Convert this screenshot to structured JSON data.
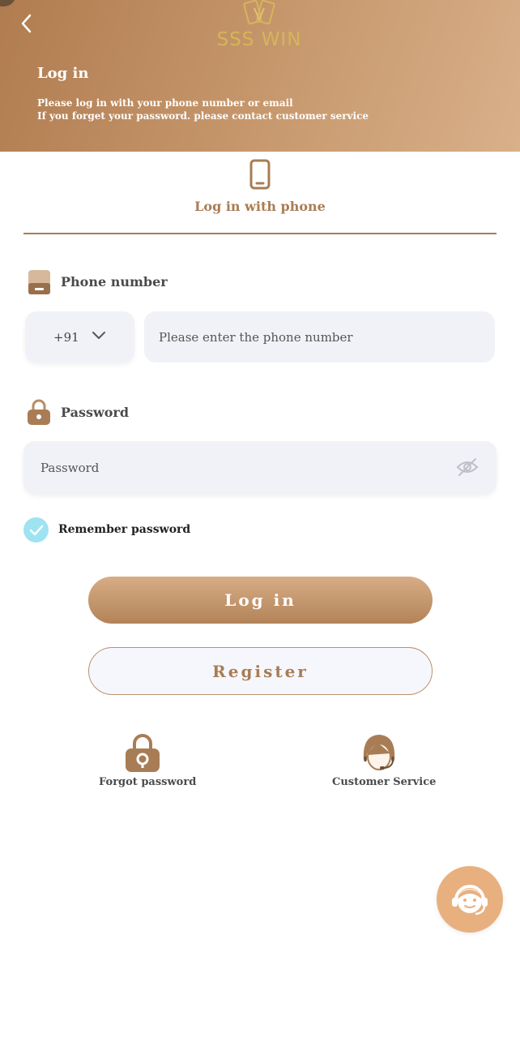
{
  "header": {
    "brand": "SSS WIN",
    "title": "Log in",
    "subtitle_line1": "Please log in with your phone number or email",
    "subtitle_line2": "If you forget your password. please contact customer service"
  },
  "tab": {
    "label": "Log in with phone",
    "icon": "phone-icon"
  },
  "phone": {
    "label": "Phone number",
    "country_code": "+91",
    "placeholder": "Please enter the phone number"
  },
  "password": {
    "label": "Password",
    "placeholder": "Password"
  },
  "remember": {
    "label": "Remember password",
    "checked": true
  },
  "buttons": {
    "login": "Log in",
    "register": "Register"
  },
  "shortcuts": {
    "forgot": "Forgot password",
    "service": "Customer Service"
  },
  "colors": {
    "accent": "#a87d55",
    "header_start": "#b07c50",
    "header_end": "#d8b08a",
    "check": "#9ee3f2",
    "input_bg": "#f1f2f8",
    "fab": "#e8b07f"
  }
}
